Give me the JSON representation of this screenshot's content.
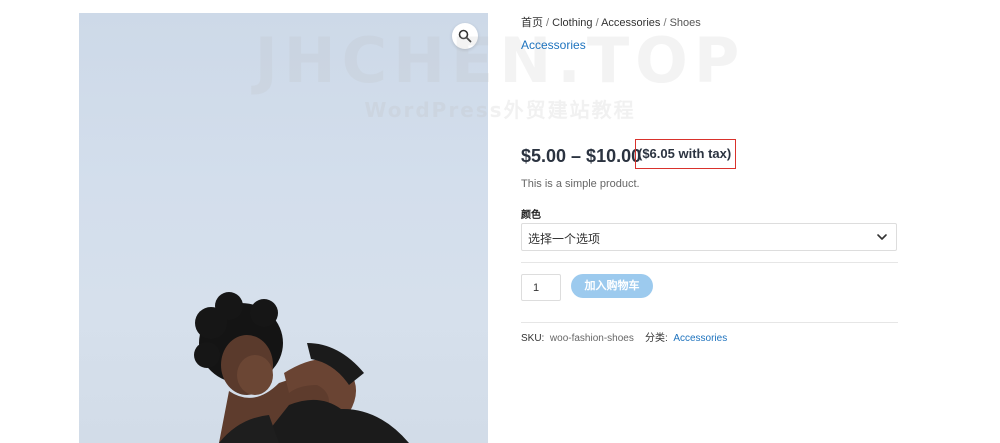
{
  "watermark": {
    "main": "JHCHEN.TOP",
    "sub": "WordPress外贸建站教程"
  },
  "gallery": {
    "zoom_icon": "magnifier-icon"
  },
  "breadcrumb": {
    "home": "首页",
    "separator": " / ",
    "level1": "Clothing",
    "level2": "Accessories",
    "current": "Shoes"
  },
  "product": {
    "category_link": "Accessories",
    "price_range": "$5.00 – $10.00",
    "tax_note": "($6.05 with tax)",
    "short_description": "This is a simple product."
  },
  "variation": {
    "label": "颜色",
    "selected": "选择一个选项",
    "chevron_icon": "chevron-down-icon"
  },
  "cart": {
    "quantity": "1",
    "add_button": "加入购物车"
  },
  "meta": {
    "sku_label": "SKU:",
    "sku_value": "woo-fashion-shoes",
    "category_label": "分类:",
    "category_value": "Accessories"
  },
  "colors": {
    "accent_link": "#1e73be",
    "button_bg": "#9ccaee",
    "highlight_border": "#d9322c",
    "price_text": "#2b3340"
  }
}
